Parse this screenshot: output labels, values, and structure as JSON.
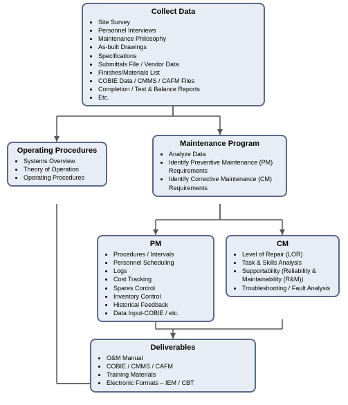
{
  "collect": {
    "title": "Collect Data",
    "items": [
      "Site Survey",
      "Personnel Interviews",
      "Maintenance Philosophy",
      "As-built Drawings",
      "Specifications",
      "Submittals File / Vendor Data",
      "Finishes/Materials List",
      "COBIE Data / CMMS / CAFM Files",
      "Completion / Test & Balance Reports",
      "Etc."
    ]
  },
  "operating": {
    "title": "Operating Procedures",
    "items": [
      "Systems Overview",
      "Theory of Operation",
      "Operating Procedures"
    ]
  },
  "maintenance": {
    "title": "Maintenance Program",
    "items": [
      "Analyze Data",
      "Identify Preventive Maintenance (PM) Requirements",
      "Identify Corrective Maintenance (CM) Requirements"
    ]
  },
  "pm": {
    "title": "PM",
    "items": [
      "Procedures / Intervals",
      "Personnel Scheduling",
      "Logs",
      "Cost Tracking",
      "Spares Control",
      "Inventory Control",
      "Historical Feedback",
      "Data Input-COBIE / etc."
    ]
  },
  "cm": {
    "title": "CM",
    "items": [
      "Level of Repair (LOR)",
      "Task & Skills Analysis",
      "Supportability (Reliability & Maintainability (R&M))",
      "Troubleshooting / Fault Analysis"
    ]
  },
  "deliverables": {
    "title": "Deliverables",
    "items": [
      "O&M Manual",
      "COBIE / CMMS / CAFM",
      "Training Materials",
      "Electronic Formats – IEM / CBT"
    ]
  }
}
